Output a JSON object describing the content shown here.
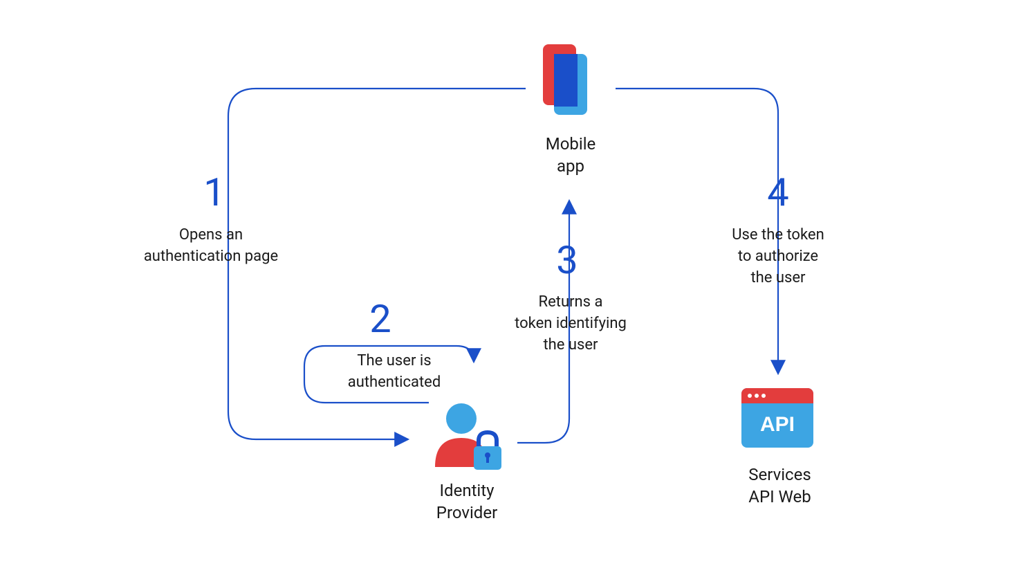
{
  "nodes": {
    "mobile_app": "Mobile\napp",
    "identity_provider": "Identity\nProvider",
    "services_api": "Services\nAPI Web"
  },
  "steps": {
    "s1": {
      "num": "1",
      "text": "Opens an\nauthentication page"
    },
    "s2": {
      "num": "2",
      "text": "The user is\nauthenticated"
    },
    "s3": {
      "num": "3",
      "text": "Returns a\ntoken identifying\nthe user"
    },
    "s4": {
      "num": "4",
      "text": "Use the token\nto authorize\nthe user"
    }
  },
  "api_label": "API",
  "colors": {
    "blue": "#1a4fc9",
    "red": "#e33d3d",
    "lightblue": "#3da5e3",
    "stroke": "#1a4fc9"
  }
}
